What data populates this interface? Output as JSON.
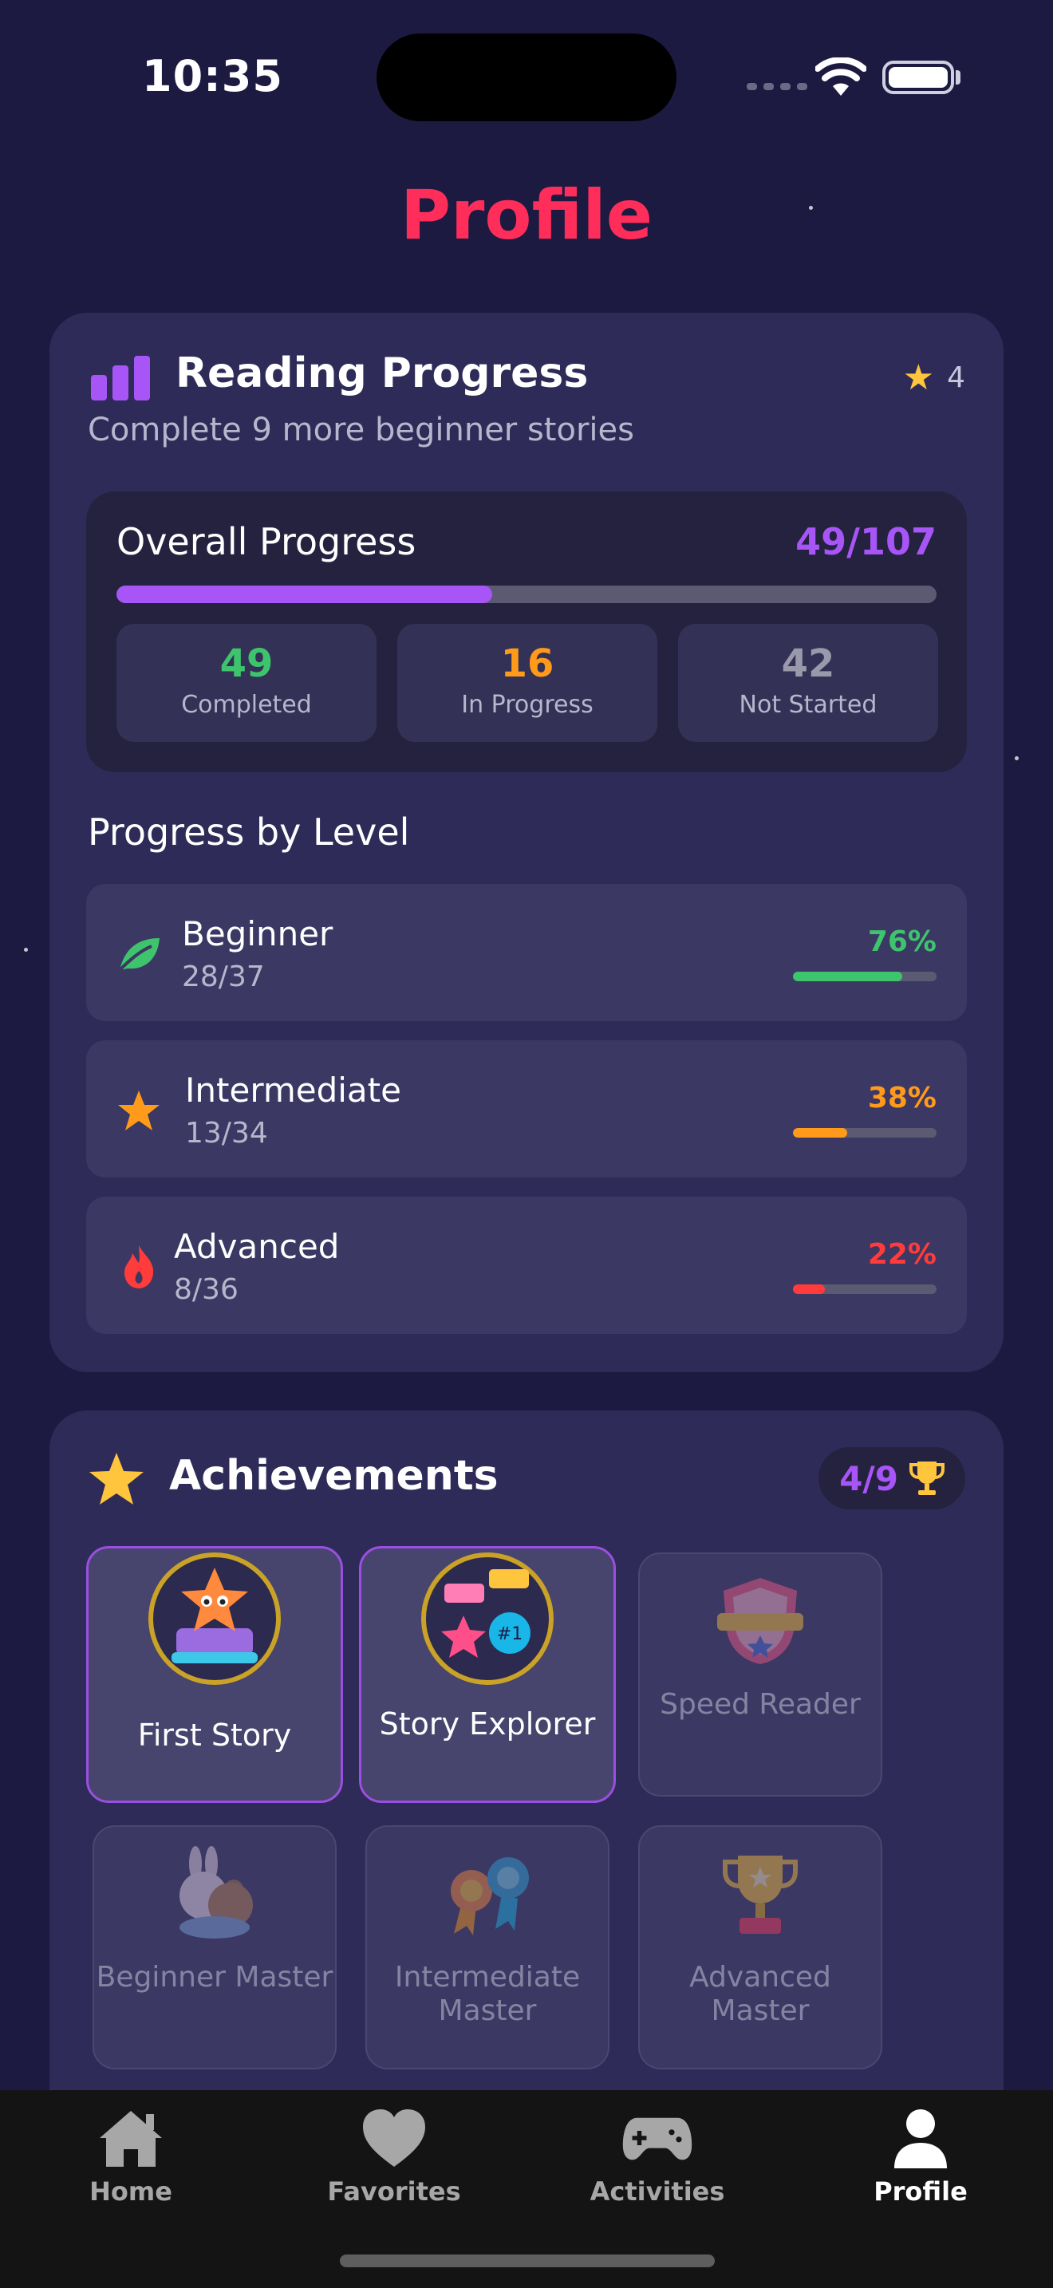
{
  "status_bar": {
    "time": "10:35"
  },
  "page": {
    "title": "Profile"
  },
  "reading_progress": {
    "title": "Reading Progress",
    "star_count": "4",
    "subtitle": "Complete 9 more beginner stories",
    "overall": {
      "label": "Overall Progress",
      "value": "49/107",
      "fraction": 0.458,
      "stats": [
        {
          "number": "49",
          "label": "Completed",
          "color": "#3ec46d"
        },
        {
          "number": "16",
          "label": "In Progress",
          "color": "#ff9a1a"
        },
        {
          "number": "42",
          "label": "Not Started",
          "color": "#9a99ac"
        }
      ]
    },
    "levels_heading": "Progress by Level",
    "levels": [
      {
        "name": "Beginner",
        "count": "28/37",
        "percent": "76%",
        "fraction": 0.76,
        "color": "#3ec46d",
        "icon": "leaf-icon"
      },
      {
        "name": "Intermediate",
        "count": "13/34",
        "percent": "38%",
        "fraction": 0.38,
        "color": "#ff9a1a",
        "icon": "star-icon"
      },
      {
        "name": "Advanced",
        "count": "8/36",
        "percent": "22%",
        "fraction": 0.22,
        "color": "#ff3b3b",
        "icon": "flame-icon"
      }
    ]
  },
  "achievements": {
    "title": "Achievements",
    "count": "4/9",
    "items": [
      {
        "label": "First Story",
        "unlocked": true,
        "icon": "star-cake-badge-icon"
      },
      {
        "label": "Story Explorer",
        "unlocked": true,
        "icon": "medals-badge-icon"
      },
      {
        "label": "Speed Reader",
        "unlocked": false,
        "icon": "champion-shield-icon"
      },
      {
        "label": "Beginner Master",
        "unlocked": false,
        "icon": "bunny-bear-icon"
      },
      {
        "label": "Intermediate Master",
        "unlocked": false,
        "icon": "ribbon-medals-icon"
      },
      {
        "label": "Advanced Master",
        "unlocked": false,
        "icon": "trophy-icon"
      }
    ]
  },
  "tab_bar": {
    "tabs": [
      {
        "label": "Home",
        "icon": "home-icon",
        "active": false
      },
      {
        "label": "Favorites",
        "icon": "heart-icon",
        "active": false
      },
      {
        "label": "Activities",
        "icon": "gamepad-icon",
        "active": false
      },
      {
        "label": "Profile",
        "icon": "person-icon",
        "active": true
      }
    ]
  },
  "colors": {
    "background": "#1d1a42",
    "card": "#2e2b58",
    "accent_purple": "#a855f7",
    "title_pink": "#ff2d5a",
    "gold": "#ffc53d"
  }
}
